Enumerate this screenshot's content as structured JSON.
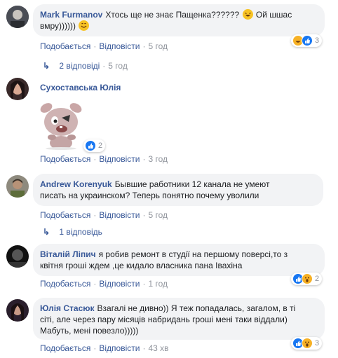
{
  "colors": {
    "link": "#385898",
    "meta": "#90949c",
    "bubble": "#f2f3f5",
    "like": "#1877f2",
    "emoji": "#f7b125"
  },
  "comments": [
    {
      "author": "Mark Furmanov",
      "text": "Хтось ще не знає Пащенка??????",
      "text2": "Ой шшас",
      "text3": "вмру))))))",
      "like": "Подобається",
      "reply": "Відповісти",
      "time": "5 год",
      "reactions": {
        "icons": [
          "haha-icon",
          "like-icon"
        ],
        "count": "3"
      },
      "replies": {
        "label": "2 відповіді",
        "time": "5 год"
      }
    },
    {
      "author": "Сухоставська Юлія",
      "sticker": "rabbit-sticker",
      "like": "Подобається",
      "reply": "Відповісти",
      "time": "3 год",
      "reactions": {
        "icons": [
          "like-icon"
        ],
        "count": "2"
      }
    },
    {
      "author": "Andrew Korenyuk",
      "text": "Бывшие работники 12 канала не умеют",
      "text2": "писать на украинском? Теперь понятно почему уволили",
      "like": "Подобається",
      "reply": "Відповісти",
      "time": "5 год",
      "replies": {
        "label": "1 відповідь"
      }
    },
    {
      "author": "Віталій Ліпич",
      "text": "я робив ремонт в студії на першому поверсі,то з",
      "text2": "квітня гроші ждем ,це кидало власника пана Івахіна",
      "like": "Подобається",
      "reply": "Відповісти",
      "time": "1 год",
      "reactions": {
        "icons": [
          "like-icon",
          "wow-icon"
        ],
        "count": "2"
      }
    },
    {
      "author": "Юлія Стасюк",
      "text": "Взагалі не дивно)) Я теж попадалась, загалом, в ті",
      "text2": "сіті, але через пару місяців набридань гроші мені таки віддали)",
      "text3": "Мабуть, мені повезло)))))",
      "like": "Подобається",
      "reply": "Відповісти",
      "time": "43 хв",
      "reactions": {
        "icons": [
          "like-icon",
          "wow-icon"
        ],
        "count": "3"
      }
    }
  ]
}
